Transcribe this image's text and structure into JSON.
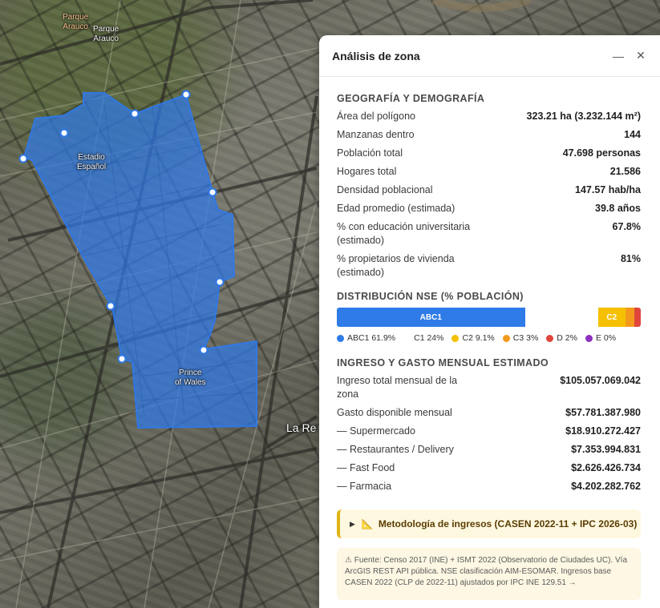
{
  "map": {
    "labels": {
      "parque_arauco_1": "Parque\nArauco",
      "parque_arauco_2": "Parque\nArauco",
      "estadio_espanol": "Estadio\nEspañol",
      "prince_of_wales": "Prince\nof Wales",
      "la_re": "La Re"
    },
    "polygon_color": "#2f78e8"
  },
  "panel": {
    "title": "Análisis de zona",
    "minimize_icon": "minimize-icon",
    "close_icon": "close-icon",
    "sections": {
      "geo": {
        "title": "GEOGRAFÍA Y DEMOGRAFÍA",
        "rows": [
          {
            "label": "Área del polígono",
            "value": "323.21 ha (3.232.144 m²)"
          },
          {
            "label": "Manzanas dentro",
            "value": "144"
          },
          {
            "label": "Población total",
            "value": "47.698 personas"
          },
          {
            "label": "Hogares total",
            "value": "21.586"
          },
          {
            "label": "Densidad poblacional",
            "value": "147.57 hab/ha"
          },
          {
            "label": "Edad promedio (estimada)",
            "value": "39.8 años"
          },
          {
            "label": "% con educación universitaria (estimado)",
            "value": "67.8%"
          },
          {
            "label": "% propietarios de vivienda (estimado)",
            "value": "81%"
          }
        ]
      },
      "nse": {
        "title": "DISTRIBUCIÓN NSE (% POBLACIÓN)",
        "segments": [
          {
            "name": "ABC1",
            "pct": 61.9,
            "color": "#2f7be8",
            "bar_label": "ABC1"
          },
          {
            "name": "C1",
            "pct": 24,
            "color": "#ffffff",
            "bar_label": ""
          },
          {
            "name": "C2",
            "pct": 9.1,
            "color": "#f5c000",
            "bar_label": "C2"
          },
          {
            "name": "C3",
            "pct": 3,
            "color": "#f39a1c",
            "bar_label": ""
          },
          {
            "name": "D",
            "pct": 2,
            "color": "#e0463c",
            "bar_label": ""
          },
          {
            "name": "E",
            "pct": 0,
            "color": "#8e2fc0",
            "bar_label": ""
          }
        ],
        "legend": [
          "ABC1 61.9%",
          "C1 24%",
          "C2 9.1%",
          "C3 3%",
          "D 2%",
          "E 0%"
        ]
      },
      "income": {
        "title": "INGRESO Y GASTO MENSUAL ESTIMADO",
        "rows": [
          {
            "label": "Ingreso total mensual de la zona",
            "value": "$105.057.069.042"
          },
          {
            "label": "Gasto disponible mensual",
            "value": "$57.781.387.980"
          },
          {
            "label": "— Supermercado",
            "value": "$18.910.272.427"
          },
          {
            "label": "— Restaurantes / Delivery",
            "value": "$7.353.994.831"
          },
          {
            "label": "— Fast Food",
            "value": "$2.626.426.734"
          },
          {
            "label": "— Farmacia",
            "value": "$4.202.282.762"
          }
        ]
      }
    },
    "methodology": {
      "icon": "ruler-triangle-icon",
      "label": "Metodología de ingresos (CASEN 2022-11 + IPC 2026-03)"
    },
    "source": "⚠ Fuente: Censo 2017 (INE) + ISMT 2022 (Observatorio de Ciudades UC). Vía ArcGIS REST API pública. NSE clasificación AIM-ESOMAR. Ingresos base CASEN 2022 (CLP de 2022-11) ajustados por IPC INE 129.51 →"
  }
}
